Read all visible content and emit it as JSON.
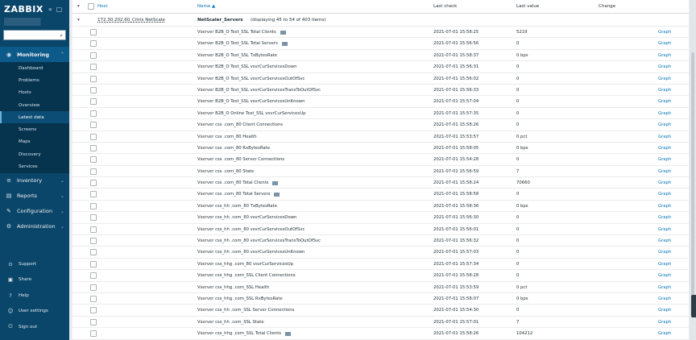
{
  "sidebar": {
    "logo": "ZABBIX",
    "collapse_glyph": "«",
    "toggle_glyph": "▢",
    "search": {
      "placeholder": "",
      "button": "⌕"
    },
    "menu": [
      {
        "label": "Monitoring",
        "icon": "eye-icon",
        "glyph": "◉",
        "chev": "⌃"
      },
      {
        "label": "Inventory",
        "icon": "list-icon",
        "glyph": "≡",
        "chev": "⌄"
      },
      {
        "label": "Reports",
        "icon": "report-icon",
        "glyph": "▤",
        "chev": "⌄"
      },
      {
        "label": "Configuration",
        "icon": "wrench-icon",
        "glyph": "✎",
        "chev": "⌄"
      },
      {
        "label": "Administration",
        "icon": "gear-icon",
        "glyph": "⚙",
        "chev": "⌄"
      }
    ],
    "submenu": [
      "Dashboard",
      "Problems",
      "Hosts",
      "Overview",
      "Latest data",
      "Screens",
      "Maps",
      "Discovery",
      "Services"
    ],
    "bottom": [
      {
        "label": "Support",
        "icon": "support-icon",
        "glyph": "⊙"
      },
      {
        "label": "Share",
        "icon": "share-icon",
        "glyph": "▣"
      },
      {
        "label": "Help",
        "icon": "help-icon",
        "glyph": "?"
      },
      {
        "label": "User settings",
        "icon": "user-icon",
        "glyph": "☺"
      },
      {
        "label": "Sign out",
        "icon": "power-icon",
        "glyph": "⏻"
      }
    ]
  },
  "table": {
    "headers": {
      "host": "Host",
      "name": "Name ▲",
      "last_check": "Last check",
      "last_value": "Last value",
      "change": "Change"
    },
    "group": {
      "expand_glyph": "▾",
      "host": "172.30.202.60_Citrix NetScale",
      "app": "NetScaler_Servers",
      "count": "(displaying 45 to 54 of 403 items)"
    },
    "rows": [
      {
        "name": "Vserver B2B_O      Test_SSL Total Clients",
        "tag": true,
        "check": "2021-07-01 15:58:25",
        "value": "5219",
        "action": "Graph"
      },
      {
        "name": "Vserver B2B_O      Test_SSL Total Servers",
        "tag": true,
        "check": "2021-07-01 15:56:56",
        "value": "0",
        "action": "Graph"
      },
      {
        "name": "Vserver B2B_O      Test_SSL TxBytesRate",
        "tag": false,
        "check": "2021-07-01 15:58:37",
        "value": "0 bps",
        "action": "Graph"
      },
      {
        "name": "Vserver B2B_O      Test_SSL vsvrCurServicesDown",
        "tag": false,
        "check": "2021-07-01 15:56:31",
        "value": "0",
        "action": "Graph"
      },
      {
        "name": "Vserver B2B_O      Test_SSL vsvrCurServicesOutOfSvc",
        "tag": false,
        "check": "2021-07-01 15:56:02",
        "value": "0",
        "action": "Graph"
      },
      {
        "name": "Vserver B2B_O      Test_SSL vsvrCurServicesTransToOutOfSvc",
        "tag": false,
        "check": "2021-07-01 15:56:33",
        "value": "0",
        "action": "Graph"
      },
      {
        "name": "Vserver B2B_O      Test_SSL vsvrCurServicesUnKnown",
        "tag": false,
        "check": "2021-07-01 15:57:04",
        "value": "0",
        "action": "Graph"
      },
      {
        "name": "Vserver B2B_O  Online  Test_SSL vsvrCurServicesUp",
        "tag": false,
        "check": "2021-07-01 15:57:35",
        "value": "0",
        "action": "Graph"
      },
      {
        "name": "Vserver css      .com_80 Client Connections",
        "tag": false,
        "check": "2021-07-01 15:58:26",
        "value": "0",
        "action": "Graph"
      },
      {
        "name": "Vserver css      .com_80 Health",
        "tag": false,
        "check": "2021-07-01 15:53:57",
        "value": "0 pct",
        "action": "Graph"
      },
      {
        "name": "Vserver css      .com_80 RxBytesRate",
        "tag": false,
        "check": "2021-07-01 15:58:05",
        "value": "0 bps",
        "action": "Graph"
      },
      {
        "name": "Vserver css      .com_80 Server Connections",
        "tag": false,
        "check": "2021-07-01 15:54:28",
        "value": "0",
        "action": "Graph"
      },
      {
        "name": "Vserver css      .com_80 State",
        "tag": false,
        "check": "2021-07-01 15:56:59",
        "value": "7",
        "action": "Graph"
      },
      {
        "name": "Vserver css      .com_80 Total Clients",
        "tag": true,
        "check": "2021-07-01 15:58:24",
        "value": "70660",
        "action": "Graph"
      },
      {
        "name": "Vserver css      .com_80 Total Servers",
        "tag": true,
        "check": "2021-07-01 15:58:58",
        "value": "0",
        "action": "Graph"
      },
      {
        "name": "Vserver css_hh      .com_80 TxBytesRate",
        "tag": false,
        "check": "2021-07-01 15:58:36",
        "value": "0 bps",
        "action": "Graph"
      },
      {
        "name": "Vserver css_hh      .com_80 vsvrCurServicesDown",
        "tag": false,
        "check": "2021-07-01 15:56:30",
        "value": "0",
        "action": "Graph"
      },
      {
        "name": "Vserver css_hh      .com_80 vsvrCurServicesOutOfSvc",
        "tag": false,
        "check": "2021-07-01 15:56:01",
        "value": "0",
        "action": "Graph"
      },
      {
        "name": "Vserver css_hh      .com_80 vsvrCurServicesTransToOutOfSvc",
        "tag": false,
        "check": "2021-07-01 15:56:32",
        "value": "0",
        "action": "Graph"
      },
      {
        "name": "Vserver css_hh      .com_80 vsvrCurServicesUnKnown",
        "tag": false,
        "check": "2021-07-01 15:57:03",
        "value": "0",
        "action": "Graph"
      },
      {
        "name": "Vserver css_hhg      .com_80 vsvrCurServicesUp",
        "tag": false,
        "check": "2021-07-01 15:57:34",
        "value": "0",
        "action": "Graph"
      },
      {
        "name": "Vserver css_hhg      .com_SSL Client Connections",
        "tag": false,
        "check": "2021-07-01 15:58:28",
        "value": "0",
        "action": "Graph"
      },
      {
        "name": "Vserver css_hhg      .com_SSL Health",
        "tag": false,
        "check": "2021-07-01 15:53:59",
        "value": "0 pct",
        "action": "Graph"
      },
      {
        "name": "Vserver css_hhg      .com_SSL RxBytesRate",
        "tag": false,
        "check": "2021-07-01 15:58:07",
        "value": "0 bps",
        "action": "Graph"
      },
      {
        "name": "Vserver css_hh      .com_SSL Server Connections",
        "tag": false,
        "check": "2021-07-01 15:54:30",
        "value": "0",
        "action": "Graph"
      },
      {
        "name": "Vserver css_hh      .com_SSL State",
        "tag": false,
        "check": "2021-07-01 15:57:01",
        "value": "7",
        "action": "Graph"
      },
      {
        "name": "Vserver css_hhg      .com_SSL Total Clients",
        "tag": true,
        "check": "2021-07-01 15:58:26",
        "value": "104212",
        "action": "Graph"
      }
    ]
  }
}
